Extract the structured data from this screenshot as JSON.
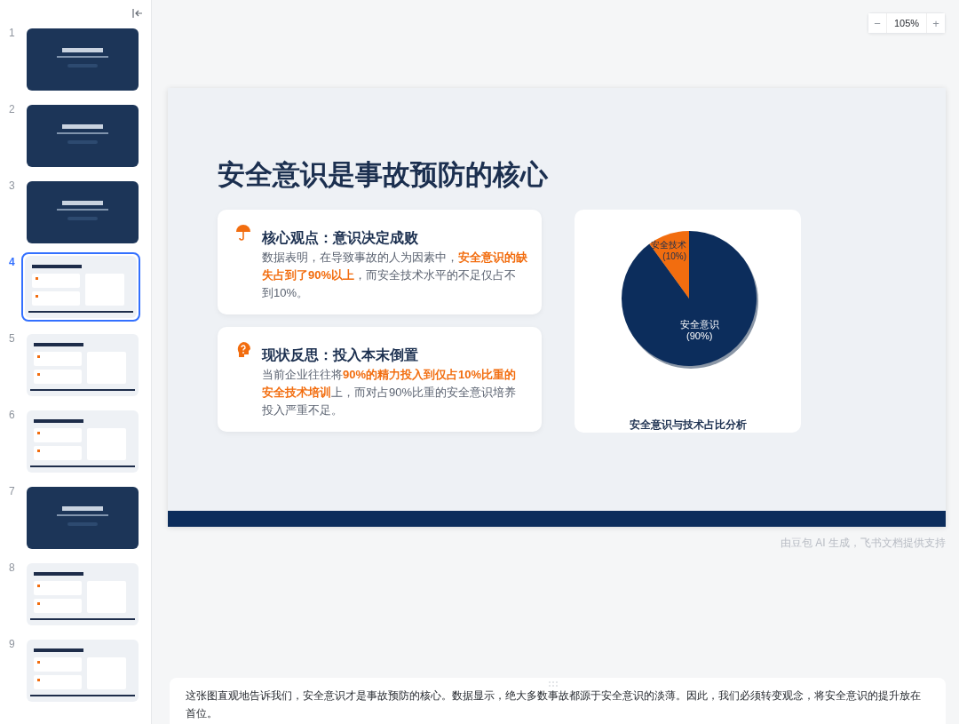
{
  "sidebar": {
    "slides": [
      {
        "number": "1",
        "kind": "dark",
        "selected": false
      },
      {
        "number": "2",
        "kind": "dark",
        "selected": false
      },
      {
        "number": "3",
        "kind": "dark",
        "selected": false
      },
      {
        "number": "4",
        "kind": "light",
        "selected": true
      },
      {
        "number": "5",
        "kind": "light",
        "selected": false
      },
      {
        "number": "6",
        "kind": "light",
        "selected": false
      },
      {
        "number": "7",
        "kind": "dark",
        "selected": false
      },
      {
        "number": "8",
        "kind": "light",
        "selected": false
      },
      {
        "number": "9",
        "kind": "light",
        "selected": false
      }
    ]
  },
  "zoom": {
    "minus": "−",
    "value": "105%",
    "plus": "+"
  },
  "slide": {
    "title": "安全意识是事故预防的核心",
    "cards": [
      {
        "heading": "核心观点：意识决定成败",
        "text": "数据表明，在导致事故的人为因素中，**安全意识的缺失占到了90%以上**，而安全技术水平的不足仅占不到10%。"
      },
      {
        "heading": "现状反思：投入本末倒置",
        "text": "当前企业往往将**90%的精力投入到仅占10%比重的安全技术培训**上，而对占90%比重的安全意识培养投入严重不足。"
      }
    ],
    "chart_data": {
      "type": "pie",
      "title": "安全意识与技术占比分析",
      "categories": [
        "安全意识",
        "安全技术"
      ],
      "values": [
        90,
        10
      ],
      "value_labels": [
        "(90%)",
        "(10%)"
      ],
      "colors": [
        "#0c2d5c",
        "#f26d0f"
      ]
    }
  },
  "credit": "由豆包 AI 生成，飞书文档提供支持",
  "notes": "这张图直观地告诉我们，安全意识才是事故预防的核心。数据显示，绝大多数事故都源于安全意识的淡薄。因此，我们必须转变观念，将安全意识的提升放在首位。"
}
